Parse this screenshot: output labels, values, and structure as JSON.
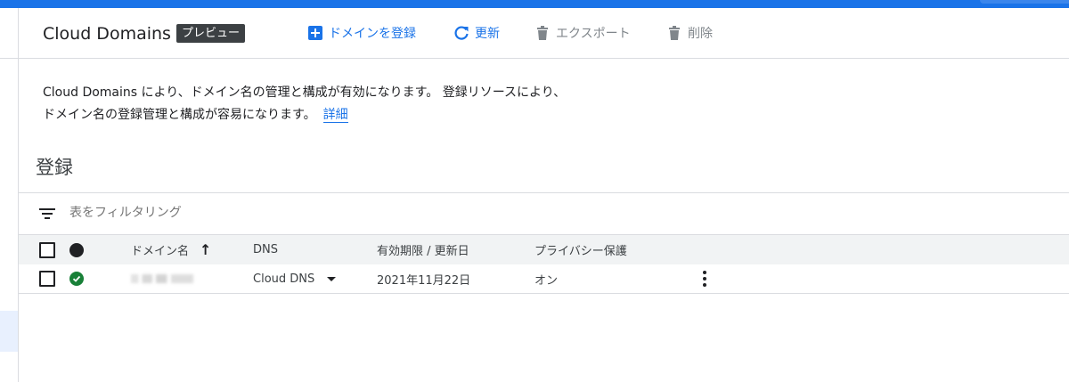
{
  "header": {
    "title": "Cloud Domains",
    "badge": "プレビュー",
    "actions": {
      "register": "ドメインを登録",
      "refresh": "更新",
      "export": "エクスポート",
      "delete": "削除"
    }
  },
  "description": {
    "text": "Cloud Domains により、ドメイン名の管理と構成が有効になります。 登録リソースにより、ドメイン名の登録管理と構成が容易になります。",
    "link": "詳細"
  },
  "section": {
    "title": "登録"
  },
  "filter": {
    "placeholder": "表をフィルタリング"
  },
  "table": {
    "columns": {
      "domain": "ドメイン名",
      "dns": "DNS",
      "expiry": "有効期限 / 更新日",
      "privacy": "プライバシー保護"
    },
    "rows": [
      {
        "dns": "Cloud DNS",
        "expiry": "2021年11月22日",
        "privacy": "オン"
      }
    ]
  },
  "colors": {
    "accent": "#1a73e8",
    "status_ok": "#188038",
    "badge_bg": "#3c4043",
    "disabled": "#80868b"
  },
  "icons": {
    "register": "add-box-icon",
    "refresh": "refresh-icon",
    "export": "trash-icon",
    "delete": "trash-icon",
    "filter": "filter-list-icon",
    "sort": "arrow-up-icon",
    "status": "check-circle-icon",
    "menu": "more-vert-icon",
    "dns": "dropdown-arrow-icon"
  }
}
